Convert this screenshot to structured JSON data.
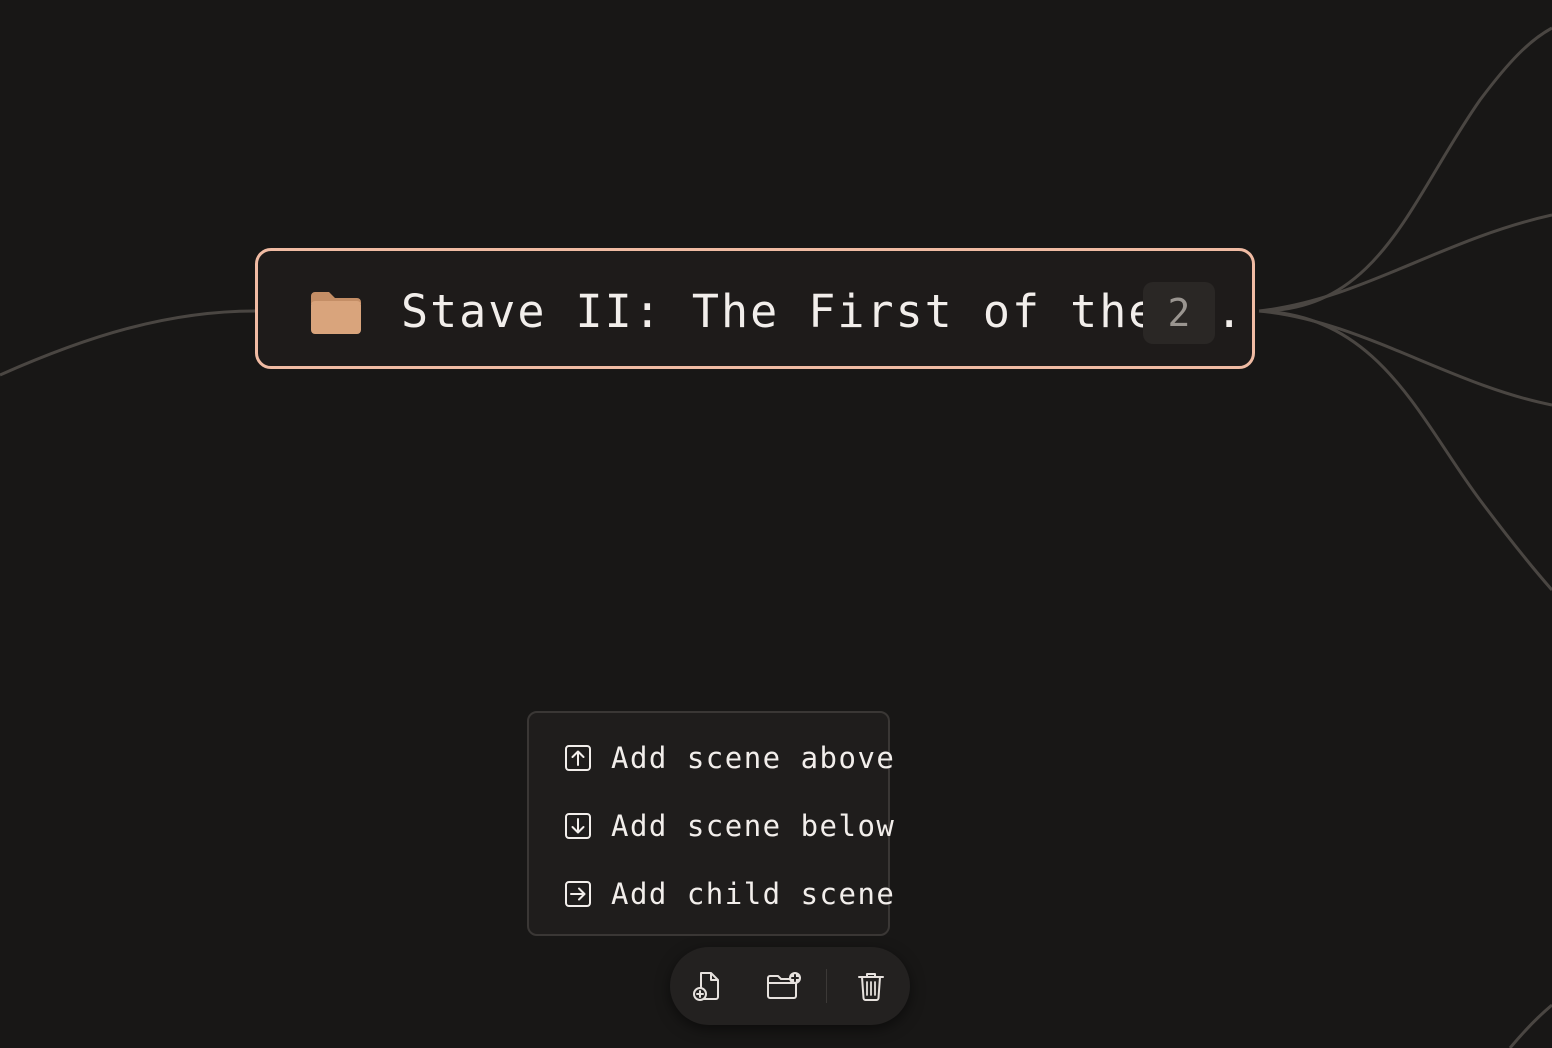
{
  "node": {
    "title": "Stave II: The First of the...",
    "count": "2",
    "icon": "folder-icon"
  },
  "menu": {
    "items": [
      {
        "label": "Add scene above",
        "icon": "arrow-up-square-icon"
      },
      {
        "label": "Add scene below",
        "icon": "arrow-down-square-icon"
      },
      {
        "label": "Add child scene",
        "icon": "arrow-right-square-icon"
      }
    ]
  },
  "toolbar": {
    "buttons": [
      {
        "icon": "add-document-icon"
      },
      {
        "icon": "add-folder-icon"
      },
      {
        "icon": "trash-icon"
      }
    ]
  },
  "colors": {
    "background": "#181716",
    "node_border": "#f0bba3",
    "folder": "#d9a47c",
    "connector": "#4a4642",
    "text": "#f2eeeb"
  }
}
